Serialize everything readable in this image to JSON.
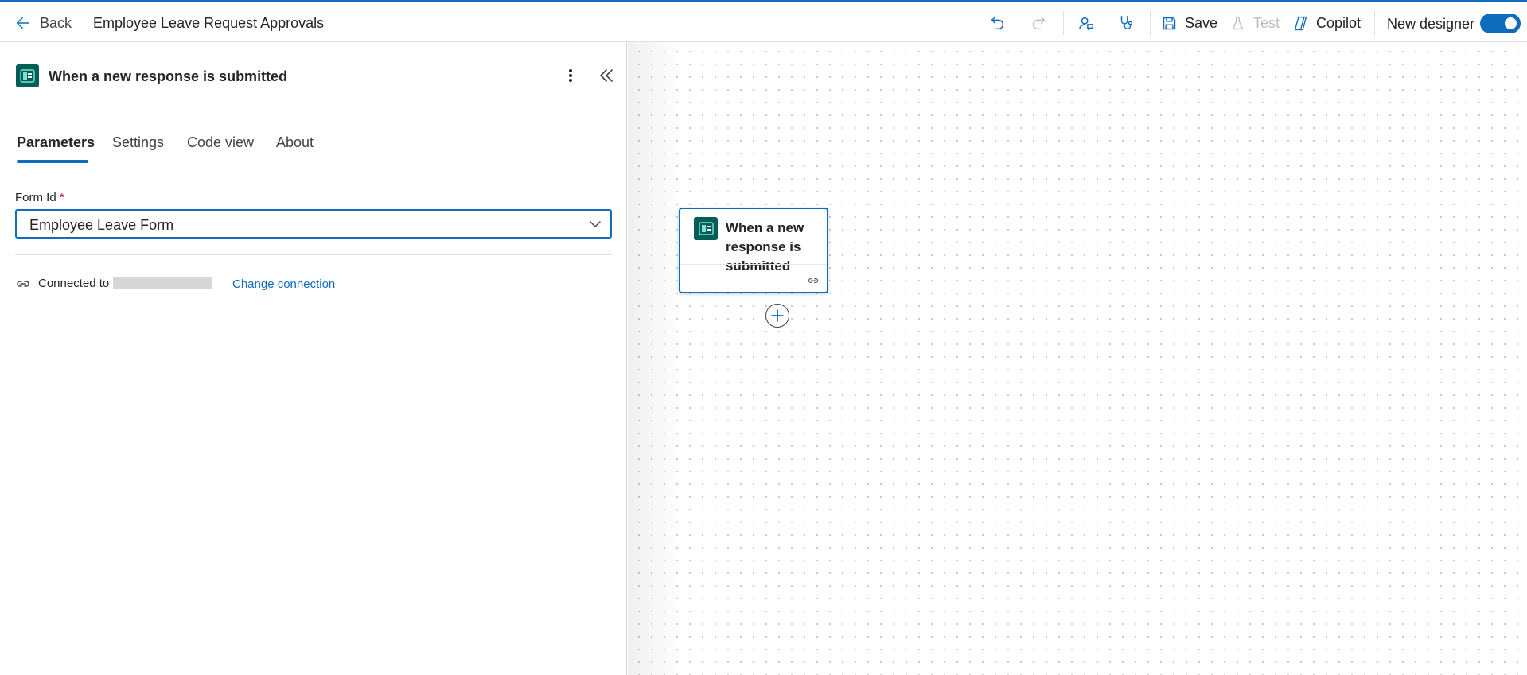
{
  "topbar": {
    "back_label": "Back",
    "flow_title": "Employee Leave Request Approvals",
    "icons": [
      "undo-icon",
      "redo-icon",
      "assistant-icon",
      "flow-checker-icon"
    ],
    "save_label": "Save",
    "test_label": "Test",
    "copilot_label": "Copilot",
    "new_designer_label": "New designer",
    "new_designer_enabled": true
  },
  "panel": {
    "title": "When a new response is submitted",
    "tabs": [
      {
        "label": "Parameters",
        "active": true
      },
      {
        "label": "Settings",
        "active": false
      },
      {
        "label": "Code view",
        "active": false
      },
      {
        "label": "About",
        "active": false
      }
    ],
    "form_id_label": "Form Id",
    "required_marker": "*",
    "form_id_value": "Employee Leave Form",
    "connected_to_label": "Connected to",
    "change_connection_label": "Change connection"
  },
  "canvas": {
    "node_title": "When a new response is submitted"
  },
  "colors": {
    "accent": "#0f6cbd",
    "forms_icon_bg": "#035e58",
    "required": "#c50f1f"
  }
}
